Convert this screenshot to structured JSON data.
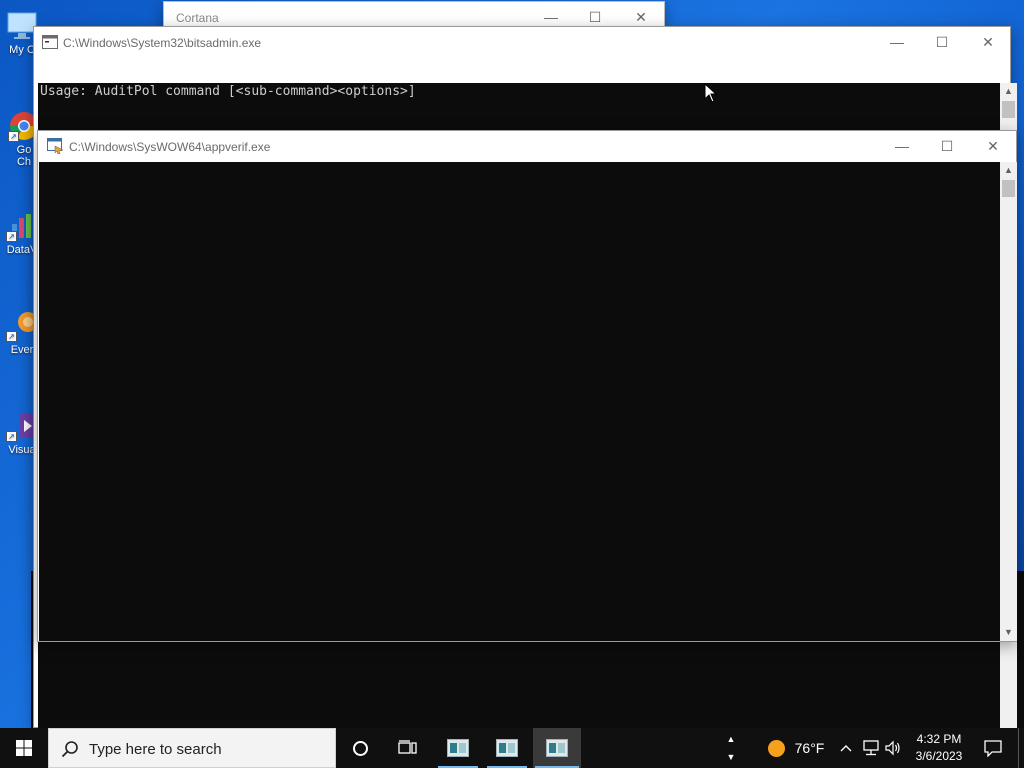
{
  "desktop": {
    "icons": [
      {
        "name": "my-computer-desktop-icon",
        "label": "My C"
      },
      {
        "name": "google-chrome-desktop-icon",
        "label": "Go Ch"
      },
      {
        "name": "dataviz-desktop-icon",
        "label": "DataV"
      },
      {
        "name": "everything-desktop-icon",
        "label": "Ever"
      },
      {
        "name": "visual-studio-desktop-icon",
        "label": "Visua"
      }
    ]
  },
  "windows": {
    "cortana": {
      "title": "Cortana"
    },
    "bitsadmin": {
      "title": "C:\\Windows\\System32\\bitsadmin.exe",
      "console_text": "Usage: AuditPol command [<sub-command><options>]"
    },
    "appverif": {
      "title": "C:\\Windows\\SysWOW64\\appverif.exe"
    }
  },
  "captions": {
    "minimize": "—",
    "maximize": "☐",
    "close": "✕"
  },
  "taskbar": {
    "search_placeholder": "Type here to search",
    "weather_temp": "76°F",
    "clock_time": "4:32 PM",
    "clock_date": "3/6/2023"
  },
  "colors": {
    "console_bg": "#0c0c0c",
    "console_fg": "#cccccc",
    "taskbar_bg": "#101010",
    "accent": "#76b9ed"
  }
}
